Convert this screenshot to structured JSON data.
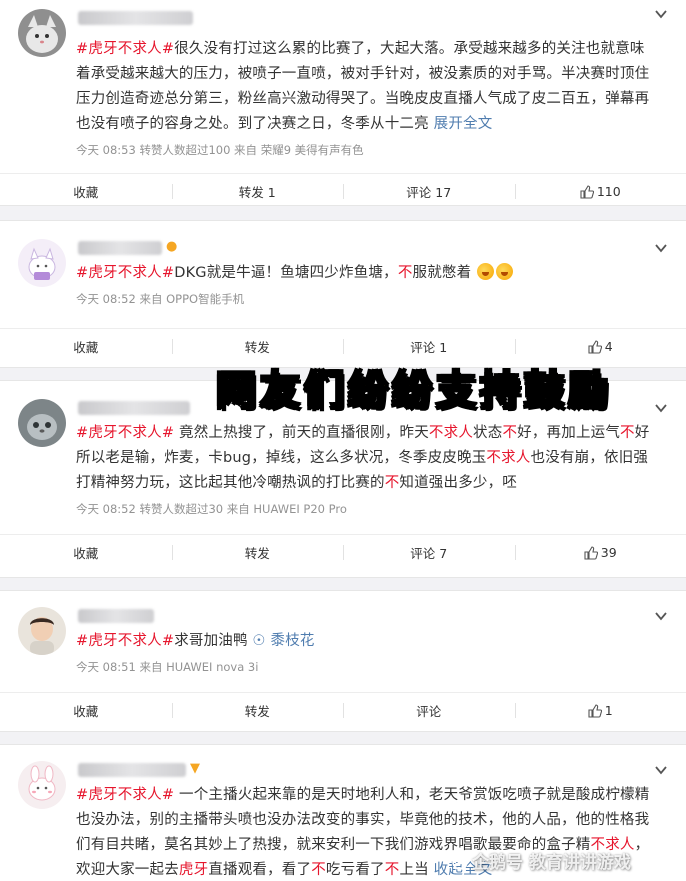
{
  "posts": [
    {
      "username": "",
      "content_before": "",
      "topic": "#虎牙不求人#",
      "content": "很久没有打过这么累的比赛了，大起大落。承受越来越多的关注也就意味着承受越来越大的压力，被喷子一直喷，被对手针对，被没素质的对手骂。半决赛时顶住压力创造奇迹总分第三，粉丝高兴激动得哭了。当晚皮皮直播人气成了皮二百五，弹幕再也没有喷子的容身之处。到了决赛之日，冬季从十二亮",
      "expand": "展开全文",
      "meta": "今天 08:53 转赞人数超过100 来自 荣耀9 美得有声有色",
      "actions": {
        "fav": "收藏",
        "repost": "转发 1",
        "comment": "评论 17",
        "like": "110"
      }
    },
    {
      "topic": "#虎牙不求人#",
      "content_a": "DKG就是牛逼！鱼塘四少炸鱼塘，",
      "hl": "不",
      "content_b": "服就憋着",
      "meta": "今天 08:52 来自 OPPO智能手机",
      "actions": {
        "fav": "收藏",
        "repost": "转发",
        "comment": "评论 1",
        "like": "4"
      }
    },
    {
      "topic": "#虎牙不求人#",
      "segments": [
        {
          "t": "竟然上热搜了，前天的直播很刚，昨天",
          "h": false
        },
        {
          "t": "不求人",
          "h": true
        },
        {
          "t": "状态",
          "h": false
        },
        {
          "t": "不",
          "h": true
        },
        {
          "t": "好，再加上运气",
          "h": false
        },
        {
          "t": "不",
          "h": true
        },
        {
          "t": "好所以老是输，炸麦，卡bug，掉线，这么多状况，冬季皮皮晚玉",
          "h": false
        },
        {
          "t": "不求人",
          "h": true
        },
        {
          "t": "也没有崩，依旧强打精神努力玩，这比起其他冷嘲热讽的打比赛的",
          "h": false
        },
        {
          "t": "不",
          "h": true
        },
        {
          "t": "知道强出多少，呸",
          "h": false
        }
      ],
      "meta": "今天 08:52 转赞人数超过30 来自 HUAWEI P20 Pro",
      "actions": {
        "fav": "收藏",
        "repost": "转发",
        "comment": "评论 7",
        "like": "39"
      }
    },
    {
      "topic": "#虎牙不求人#",
      "content": "求哥加油鸭",
      "location": "黍枝花",
      "meta": "今天 08:51 来自 HUAWEI nova 3i",
      "actions": {
        "fav": "收藏",
        "repost": "转发",
        "comment": "评论",
        "like": "1"
      }
    },
    {
      "topic": "#虎牙不求人#",
      "segments": [
        {
          "t": " 一个主播火起来靠的是天时地利人和，老天爷赏饭吃喷子就是酸成柠檬精也没办法，别的主播带头喷也没办法改变的事实，毕竟他的技术，他的人品，他的性格我们有目共睹，莫名其妙上了热搜，就来安利一下我们游戏界唱歌最要命的盒子精",
          "h": false
        },
        {
          "t": "不求人",
          "h": true
        },
        {
          "t": "，欢迎大家一起去",
          "h": false
        },
        {
          "t": "虎牙",
          "h": true
        },
        {
          "t": "直播观看，看了",
          "h": false
        },
        {
          "t": "不",
          "h": true
        },
        {
          "t": "吃亏看了",
          "h": false
        },
        {
          "t": "不",
          "h": true
        },
        {
          "t": "上当 ",
          "h": false
        }
      ],
      "expand": "收起全文"
    }
  ],
  "banner": "网友们纷纷支持鼓励",
  "watermark": "企鹅号 教育讲讲游戏"
}
